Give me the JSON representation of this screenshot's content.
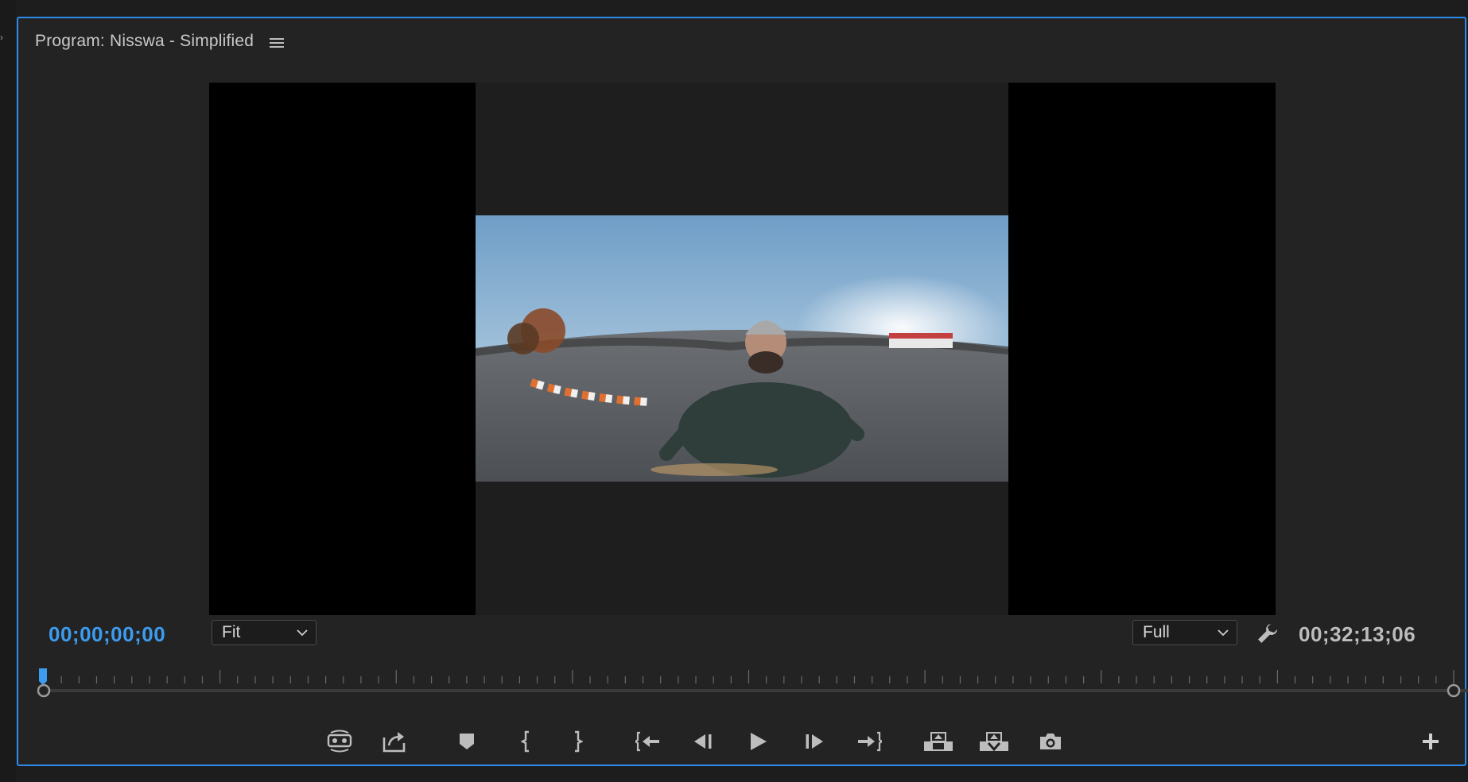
{
  "panel": {
    "title": "Program: Nisswa - Simplified",
    "menu_icon": "hamburger-menu-icon"
  },
  "viewer": {
    "frame_description_icon": "360-video-frame"
  },
  "controls": {
    "current_timecode": "00;00;00;00",
    "zoom_select": {
      "value": "Fit"
    },
    "resolution_select": {
      "value": "Full"
    },
    "settings_icon": "wrench-icon",
    "duration_timecode": "00;32;13;06"
  },
  "timeline": {
    "playhead_position": 0.0
  },
  "transport": {
    "buttons": [
      {
        "name": "vr-video-toggle",
        "icon": "vr-headset-icon"
      },
      {
        "name": "export-frame",
        "icon": "export-icon"
      },
      {
        "name": "add-marker",
        "icon": "marker-icon"
      },
      {
        "name": "mark-in",
        "icon": "mark-in-icon"
      },
      {
        "name": "mark-out",
        "icon": "mark-out-icon"
      },
      {
        "name": "go-to-in",
        "icon": "go-to-in-icon"
      },
      {
        "name": "step-back",
        "icon": "step-back-icon"
      },
      {
        "name": "play",
        "icon": "play-icon"
      },
      {
        "name": "step-forward",
        "icon": "step-forward-icon"
      },
      {
        "name": "go-to-out",
        "icon": "go-to-out-icon"
      },
      {
        "name": "lift",
        "icon": "lift-icon"
      },
      {
        "name": "extract",
        "icon": "extract-icon"
      },
      {
        "name": "export-frame-camera",
        "icon": "camera-icon"
      },
      {
        "name": "button-editor",
        "icon": "plus-icon"
      }
    ]
  },
  "colors": {
    "accent": "#2d8ceb",
    "timecode_current": "#3d9cf0",
    "panel_bg": "#232323"
  }
}
